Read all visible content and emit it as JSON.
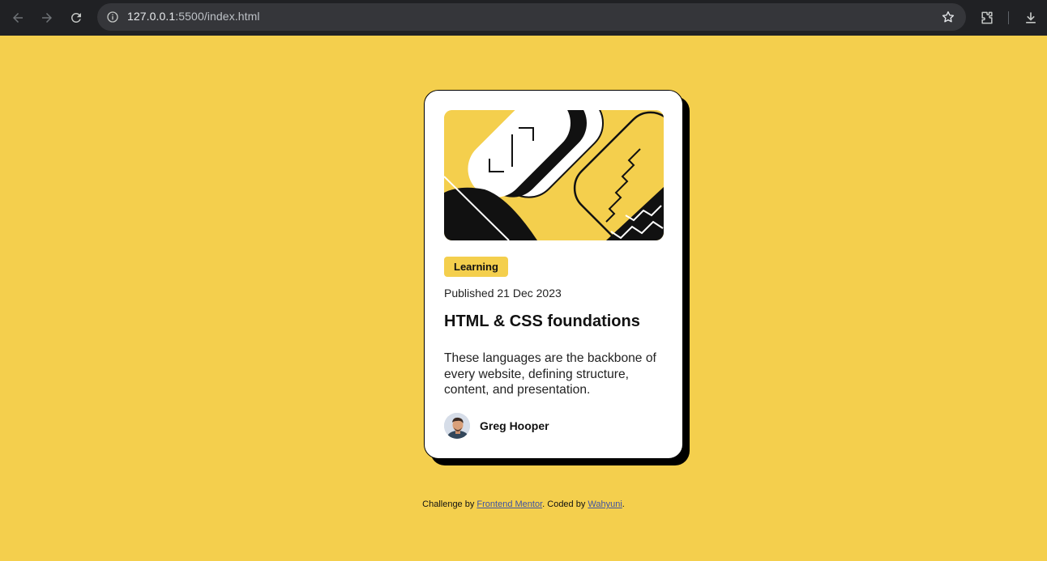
{
  "browser": {
    "url_host": "127.0.0.1",
    "url_rest": ":5500/index.html"
  },
  "card": {
    "tag": "Learning",
    "published": "Published 21 Dec 2023",
    "title": "HTML & CSS foundations",
    "description": "These languages are the backbone of every website, defining structure, content, and presentation.",
    "author": "Greg Hooper"
  },
  "attribution": {
    "prefix": "Challenge by ",
    "link1": "Frontend Mentor",
    "middle": ". Coded by ",
    "link2": "Wahyuni",
    "suffix": "."
  },
  "colors": {
    "background": "#f4cf4d",
    "card": "#ffffff",
    "text": "#111111",
    "chrome": "#202124"
  }
}
